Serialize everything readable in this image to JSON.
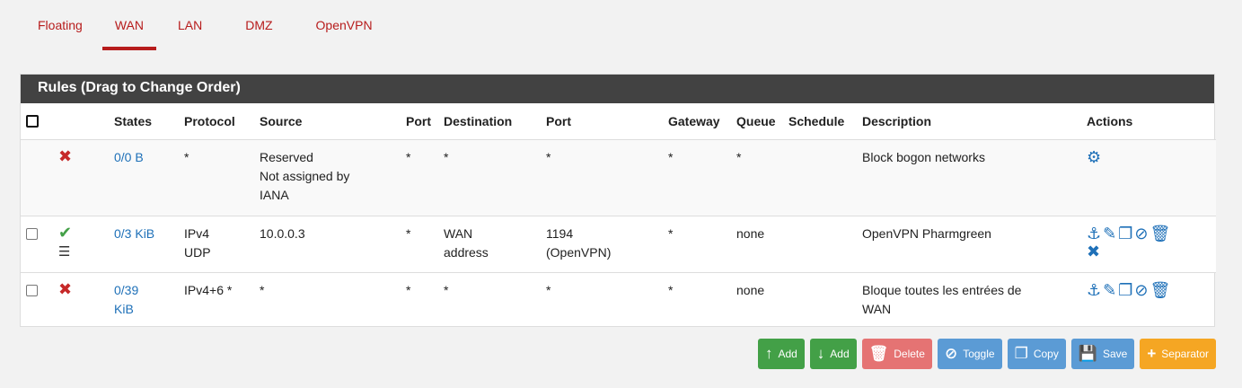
{
  "tabs": [
    "Floating",
    "WAN",
    "LAN",
    "DMZ",
    "OpenVPN"
  ],
  "active_tab": "WAN",
  "panel_title": "Rules (Drag to Change Order)",
  "columns": [
    "",
    "",
    "States",
    "Protocol",
    "Source",
    "Port",
    "Destination",
    "Port",
    "Gateway",
    "Queue",
    "Schedule",
    "Description",
    "Actions"
  ],
  "rows": [
    {
      "status_icon": "✖",
      "states": "0/0 B",
      "protocol": [
        "*"
      ],
      "source": [
        "Reserved",
        "Not assigned by",
        "IANA"
      ],
      "src_port": "*",
      "destination": [
        "*"
      ],
      "dst_port": [
        "*"
      ],
      "gateway": "*",
      "queue": "*",
      "schedule": "",
      "description": [
        "Block bogon networks"
      ],
      "actions": [
        "gear"
      ]
    },
    {
      "status_icon": "✔",
      "states": "0/3 KiB",
      "protocol": [
        "IPv4",
        "UDP"
      ],
      "source": [
        "10.0.0.3"
      ],
      "src_port": "*",
      "destination": [
        "WAN",
        "address"
      ],
      "dst_port": [
        "1194",
        "(OpenVPN)"
      ],
      "gateway": "*",
      "queue": "none",
      "schedule": "",
      "description": [
        "OpenVPN Pharmgreen"
      ],
      "actions": [
        "anchor",
        "pencil",
        "copy",
        "disable",
        "trash",
        "delete"
      ]
    },
    {
      "status_icon": "✖",
      "states": [
        "0/39",
        "KiB"
      ],
      "protocol": [
        "IPv4+6 *"
      ],
      "source": [
        "*"
      ],
      "src_port": "*",
      "destination": [
        "*"
      ],
      "dst_port": [
        "*"
      ],
      "gateway": "*",
      "queue": "none",
      "schedule": "",
      "description": [
        "Bloque toutes les entrées de",
        "WAN"
      ],
      "actions": [
        "anchor",
        "pencil",
        "copy",
        "disable",
        "trash"
      ]
    }
  ],
  "buttons": {
    "add_top": "Add",
    "add_bottom": "Add",
    "delete": "Delete",
    "toggle": "Toggle",
    "copy": "Copy",
    "save": "Save",
    "separator": "Separator"
  },
  "colors": {
    "accent": "#b71c1c",
    "header_bg": "#424242",
    "link": "#1e70b8",
    "green": "#43a047",
    "red": "#e57373",
    "blue": "#5b9bd5",
    "orange": "#f5a623"
  }
}
